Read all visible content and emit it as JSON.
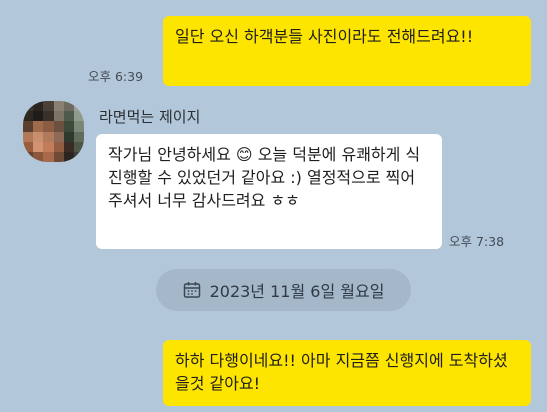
{
  "colors": {
    "background": "#b2c7da",
    "my_bubble": "#fee500",
    "their_bubble": "#ffffff",
    "date_pill": "#a4b8ca"
  },
  "messages": [
    {
      "direction": "outgoing",
      "text": "일단 오신 하객분들 사진이라도 전해드려요!!",
      "time": "오후 6:39"
    },
    {
      "direction": "incoming",
      "sender": "라면먹는 제이지",
      "text": "작가님 안녕하세요 😊 오늘 덕분에 유쾌하게 식 진행할 수 있었던거 같아요 :) 열정적으로 찍어 주셔서 너무 감사드려요 ㅎㅎ",
      "time": "오후 7:38"
    },
    {
      "direction": "outgoing",
      "text": "하하 다행이네요!! 아마 지금쯤 신행지에 도착하셨을것 같아요!"
    }
  ],
  "date_divider": {
    "icon": "calendar-icon",
    "label": "2023년 11월 6일 월요일"
  }
}
